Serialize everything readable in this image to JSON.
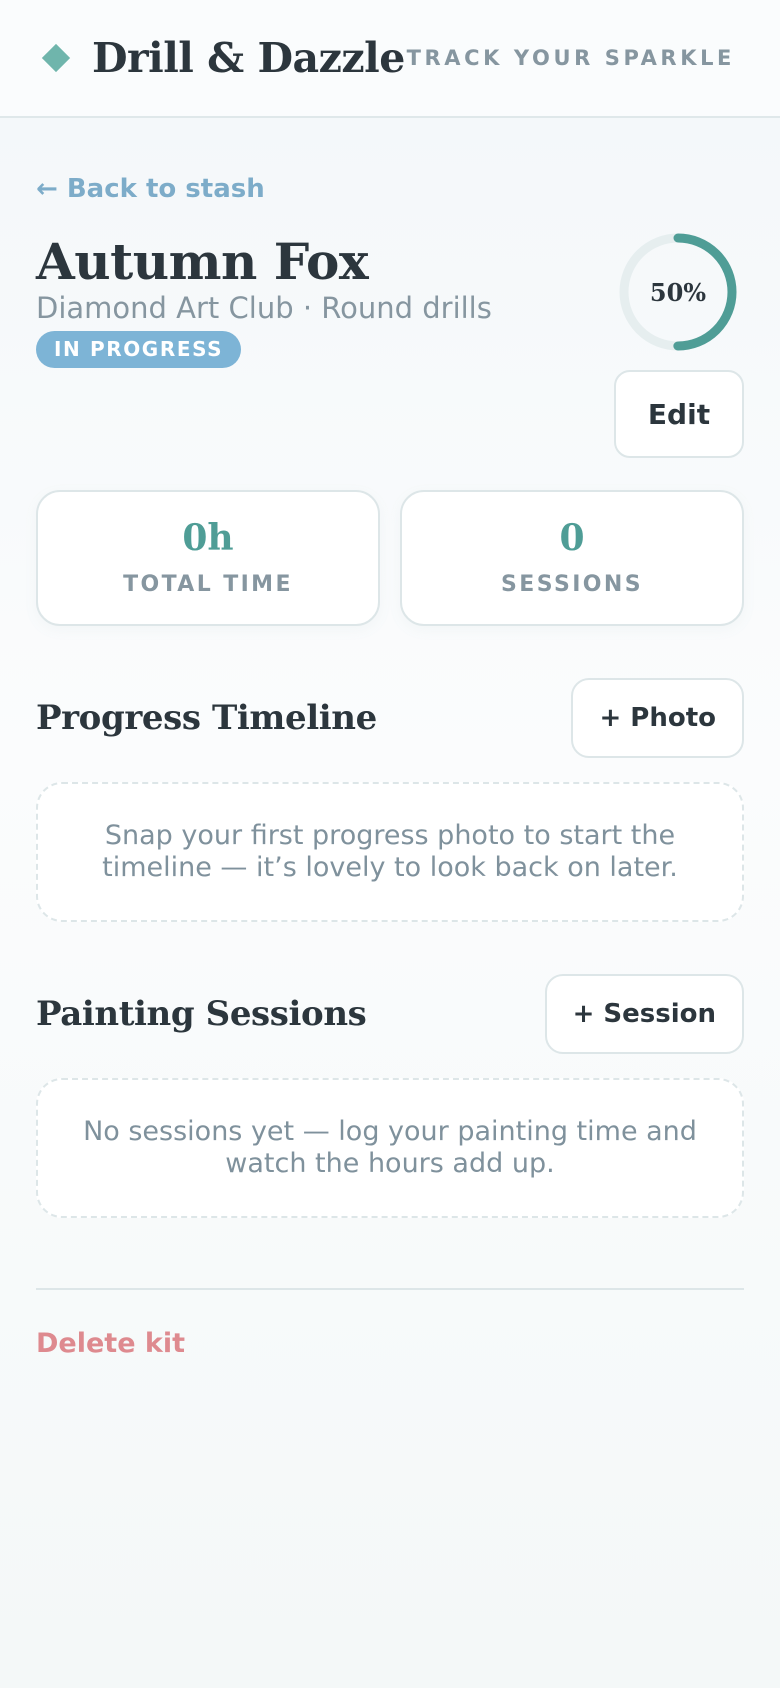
{
  "header": {
    "brand_icon": "diamond-icon",
    "brand_title": "Drill & Dazzle",
    "tagline": "TRACK YOUR SPARKLE"
  },
  "nav": {
    "back_label": "← Back to stash"
  },
  "kit": {
    "title": "Autumn Fox",
    "subtitle": "Diamond Art Club · Round drills",
    "status": "IN PROGRESS",
    "progress_percent": 50,
    "progress_label": "50%",
    "edit_label": "Edit"
  },
  "stats": [
    {
      "value": "0h",
      "label": "TOTAL TIME"
    },
    {
      "value": "0",
      "label": "SESSIONS"
    }
  ],
  "timeline": {
    "title": "Progress Timeline",
    "button_label": "+ Photo",
    "empty_text": "Snap your first progress photo to start the timeline — it’s lovely to look back on later."
  },
  "sessions": {
    "title": "Painting Sessions",
    "button_label": "+ Session",
    "empty_text": "No sessions yet — log your painting time and watch the hours add up."
  },
  "danger": {
    "delete_label": "Delete kit"
  },
  "colors": {
    "accent": "#4f9d96",
    "brand_icon": "#6fb5ac",
    "badge": "#7db4d6",
    "link": "#7dacc9",
    "danger": "#de8a8f",
    "ring_track": "#e6eeef"
  }
}
